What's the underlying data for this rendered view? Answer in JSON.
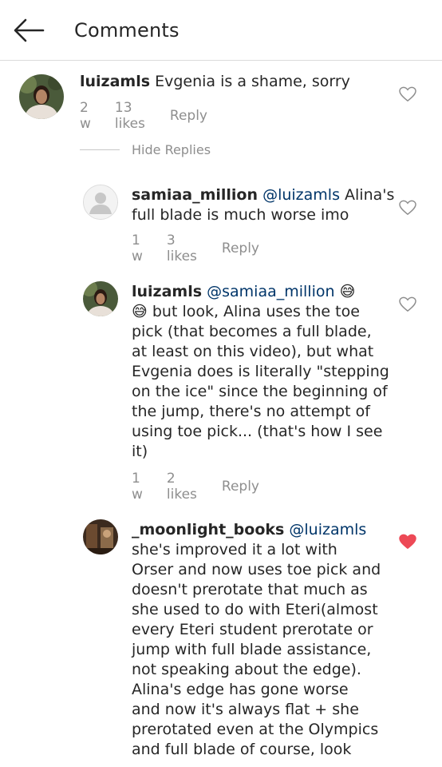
{
  "header": {
    "title": "Comments",
    "back_icon": "arrow-left-icon"
  },
  "comments": [
    {
      "username": "luizamls",
      "text": "Evgenia is a shame, sorry",
      "time": "2 w",
      "likes": "13 likes",
      "reply": "Reply",
      "liked": false
    }
  ],
  "hide_replies": "Hide Replies",
  "replies": [
    {
      "username": "samiaa_million",
      "mention": "@luizamls",
      "lines": [
        "Alina's",
        "full blade is much worse imo"
      ],
      "time": "1 w",
      "likes": "3 likes",
      "reply": "Reply",
      "liked": false
    },
    {
      "username": "luizamls",
      "mention": "@samiaa_million",
      "emoji": "😅",
      "lines": [
        "but look, Alina uses the toe",
        "pick (that becomes a full blade,",
        "at least on this video), but what",
        "Evgenia does is literally \"stepping",
        "on the ice\" since the beginning of",
        "the jump, there's no attempt of",
        "using toe pick... (that's how I see",
        "it)"
      ],
      "time": "1 w",
      "likes": "2 likes",
      "reply": "Reply",
      "liked": false
    },
    {
      "username": "_moonlight_books",
      "mention": "@luizamls",
      "lines": [
        "she's improved it a lot with",
        "Orser and now uses toe pick and",
        "doesn't prerotate that much as",
        "she used to do with Eteri(almost",
        "every Eteri student prerotate or",
        "jump with full blade assistance,",
        "not speaking about the edge).",
        "Alina's edge has gone worse",
        "and now it's always flat + she",
        "prerotated even at the Olympics",
        "and full blade of course, look"
      ],
      "liked": true
    }
  ],
  "colors": {
    "heart_liked": "#ed4956",
    "meta_gray": "#8e8e8e",
    "mention": "#003569"
  }
}
